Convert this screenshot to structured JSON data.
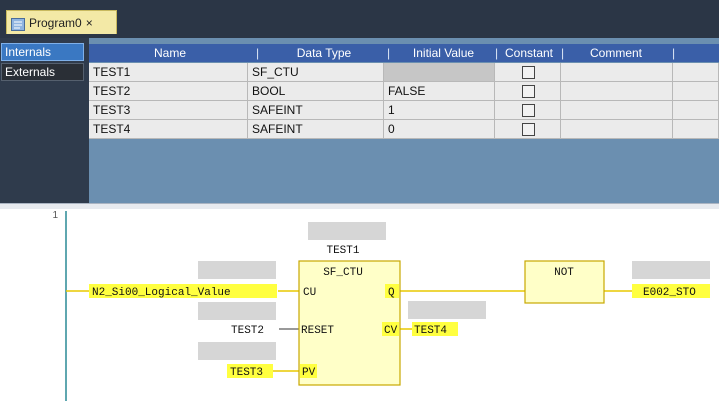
{
  "tab": {
    "label": "Program0",
    "close": "×"
  },
  "side_tabs": {
    "internals": "Internals",
    "externals": "Externals"
  },
  "variables": {
    "columns": [
      "Name",
      "Data Type",
      "Initial Value",
      "Constant",
      "Comment"
    ],
    "rows": [
      {
        "name": "TEST1",
        "type": "SF_CTU",
        "initial": "",
        "constant": false,
        "comment": ""
      },
      {
        "name": "TEST2",
        "type": "BOOL",
        "initial": "FALSE",
        "constant": false,
        "comment": ""
      },
      {
        "name": "TEST3",
        "type": "SAFEINT",
        "initial": "1",
        "constant": false,
        "comment": ""
      },
      {
        "name": "TEST4",
        "type": "SAFEINT",
        "initial": "0",
        "constant": false,
        "comment": ""
      }
    ]
  },
  "ladder": {
    "line_number": "1",
    "fb_instance": "TEST1",
    "fb_type": "SF_CTU",
    "pins": {
      "cu": "CU",
      "reset": "RESET",
      "pv": "PV",
      "q": "Q",
      "cv": "CV"
    },
    "input_cu": "N2_Si00_Logical_Value",
    "input_reset": "TEST2",
    "input_pv": "TEST3",
    "output_cv": "TEST4",
    "not_label": "NOT",
    "output_final": "E002_STO"
  },
  "colors": {
    "highlight": "#ffff40",
    "fb_fill": "#ffffc8",
    "fb_border": "#c8a800",
    "wire": "#e8c800"
  }
}
